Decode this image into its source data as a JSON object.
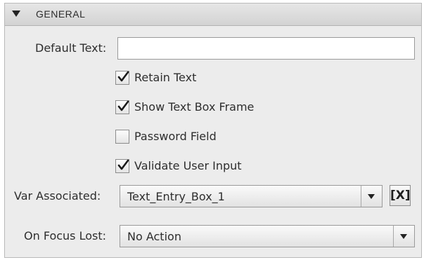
{
  "section": {
    "title": "GENERAL",
    "expanded": true
  },
  "default_text": {
    "label": "Default Text:",
    "value": ""
  },
  "checkboxes": [
    {
      "label": "Retain Text",
      "checked": true
    },
    {
      "label": "Show Text Box Frame",
      "checked": true
    },
    {
      "label": "Password Field",
      "checked": false
    },
    {
      "label": "Validate User Input",
      "checked": true
    }
  ],
  "var_associated": {
    "label": "Var Associated:",
    "value": "Text_Entry_Box_1",
    "clear_label": "[X]"
  },
  "on_focus_lost": {
    "label": "On Focus Lost:",
    "value": "No Action"
  }
}
